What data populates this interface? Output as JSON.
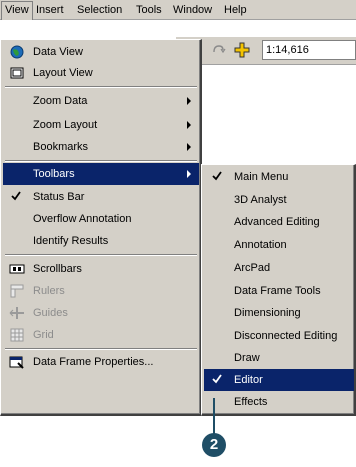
{
  "menubar": {
    "items": [
      "View",
      "Insert",
      "Selection",
      "Tools",
      "Window",
      "Help"
    ]
  },
  "toolbar": {
    "scale_value": "1:14,616"
  },
  "view_menu": {
    "items": [
      {
        "label": "Data View",
        "icon": "globe-icon"
      },
      {
        "label": "Layout View",
        "icon": "page-icon"
      },
      {
        "label": "Zoom Data",
        "submenu": true
      },
      {
        "label": "Zoom Layout",
        "submenu": true
      },
      {
        "label": "Bookmarks",
        "submenu": true
      },
      {
        "label": "Toolbars",
        "submenu": true,
        "highlighted": true
      },
      {
        "label": "Status Bar",
        "checked": true
      },
      {
        "label": "Overflow Annotation"
      },
      {
        "label": "Identify Results"
      },
      {
        "label": "Scrollbars",
        "icon": "scrollbar-icon"
      },
      {
        "label": "Rulers",
        "icon": "ruler-icon",
        "disabled": true
      },
      {
        "label": "Guides",
        "icon": "guides-icon",
        "disabled": true
      },
      {
        "label": "Grid",
        "icon": "grid-icon",
        "disabled": true
      },
      {
        "label": "Data Frame Properties...",
        "icon": "properties-icon"
      }
    ]
  },
  "toolbars_menu": {
    "items": [
      {
        "label": "Main Menu",
        "checked": true
      },
      {
        "label": "3D Analyst"
      },
      {
        "label": "Advanced Editing"
      },
      {
        "label": "Annotation"
      },
      {
        "label": "ArcPad"
      },
      {
        "label": "Data Frame Tools"
      },
      {
        "label": "Dimensioning"
      },
      {
        "label": "Disconnected Editing"
      },
      {
        "label": "Draw"
      },
      {
        "label": "Editor",
        "checked": true,
        "highlighted": true
      },
      {
        "label": "Effects"
      }
    ]
  },
  "callout": {
    "number": "2"
  },
  "colors": {
    "highlight": "#0a246a",
    "menu_bg": "#d4d0c8",
    "callout": "#1f4e66"
  }
}
